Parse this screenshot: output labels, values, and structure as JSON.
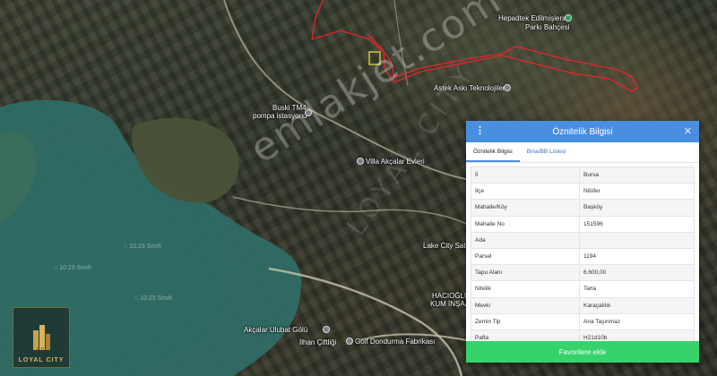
{
  "map": {
    "labels": {
      "hepadtek": "Hepadtek Edilmişlerin",
      "park": "Parkı Bahçesi",
      "astek": "Astek Askı Teknolojileri",
      "buski": "Buski TM4",
      "pompa": "pompa istasyonu",
      "villa": "Villa Akçalar Evleri",
      "lake_city": "Lake City Satış",
      "hacioglu": "HACIOĞLU",
      "kum": "KUM İNŞAAT",
      "golu": "Akçalar Ulubat Gölü",
      "ciftligi": "İlhan Çiftliği",
      "dondurma": "Golf Dondurma Fabrikası",
      "dim1": "○ 10.23 Sınıfı",
      "dim2": "○ 10.23 Sınıfı",
      "dim3": "○ 10.23 Sınıfı"
    },
    "boundary_color": "#e8242c",
    "watermark": "emlakjet.com",
    "watermark2": "LOYAL CITY"
  },
  "logo": {
    "text": "LOYAL CITY",
    "mark_text": "L.C.",
    "color": "#d9b45a"
  },
  "panel": {
    "title": "Öznitelik Bilgisi",
    "menu_icon": "⋮",
    "close_icon": "✕",
    "accent": "#4a8ee0",
    "tabs": [
      {
        "label": "Öznitelik Bilgisi"
      },
      {
        "label": "Bina/BB Listesi"
      }
    ],
    "rows": [
      {
        "key": "İl",
        "value": "Bursa"
      },
      {
        "key": "İlçe",
        "value": "Nilüfer"
      },
      {
        "key": "Mahalle/Köy",
        "value": "Başköy"
      },
      {
        "key": "Mahalle No",
        "value": "151596"
      },
      {
        "key": "Ada",
        "value": ""
      },
      {
        "key": "Parsel",
        "value": "1194"
      },
      {
        "key": "Tapu Alanı",
        "value": "6.600,00"
      },
      {
        "key": "Nitelik",
        "value": "Tarla"
      },
      {
        "key": "Mevki",
        "value": "Karaçalılık"
      },
      {
        "key": "Zemin Tip",
        "value": "Ana Taşınmaz"
      },
      {
        "key": "Pafta",
        "value": "H21d10b"
      }
    ],
    "favorite_label": "Favorilere ekle",
    "favorite_color": "#37d26b"
  }
}
